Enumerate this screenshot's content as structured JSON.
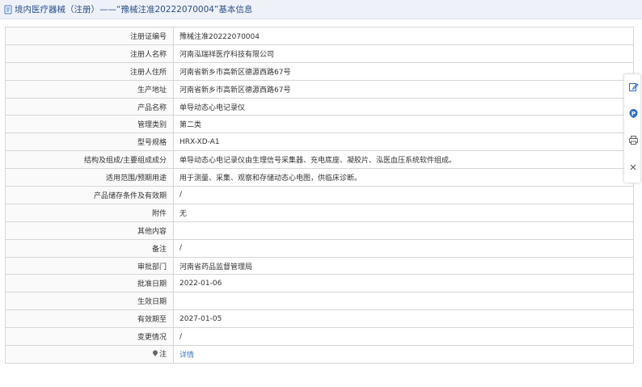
{
  "header": {
    "title": "境内医疗器械（注册）——“豫械注准20222070004”基本信息"
  },
  "rows": [
    {
      "label": "注册证编号",
      "value": "豫械注准20222070004"
    },
    {
      "label": "注册人名称",
      "value": "河南泓瑞祥医疗科技有限公司"
    },
    {
      "label": "注册人住所",
      "value": "河南省新乡市高新区德源西路67号"
    },
    {
      "label": "生产地址",
      "value": "河南省新乡市高新区德源西路67号"
    },
    {
      "label": "产品名称",
      "value": "单导动态心电记录仪"
    },
    {
      "label": "管理类别",
      "value": "第二类"
    },
    {
      "label": "型号规格",
      "value": "HRX-XD-A1"
    },
    {
      "label": "结构及组成/主要组成成分",
      "value": "单导动态心电记录仪由生理信号采集器、充电底座、凝胶片、泓医血压系统软件组成。"
    },
    {
      "label": "适用范围/预期用途",
      "value": "用于测量、采集、观察和存储动态心电图，供临床诊断。"
    },
    {
      "label": "产品储存条件及有效期",
      "value": "/"
    },
    {
      "label": "附件",
      "value": "无"
    },
    {
      "label": "其他内容",
      "value": ""
    },
    {
      "label": "备注",
      "value": "/"
    },
    {
      "label": "审批部门",
      "value": "河南省药品监督管理局"
    },
    {
      "label": "批准日期",
      "value": "2022-01-06"
    },
    {
      "label": "生效日期",
      "value": ""
    },
    {
      "label": "有效期至",
      "value": "2027-01-05"
    },
    {
      "label": "变更情况",
      "value": "/"
    }
  ],
  "note_row": {
    "label": "注",
    "link_text": "详情"
  },
  "icons": {
    "header": "document-icon",
    "note": "note-pin-icon",
    "sidebar": [
      "edit-icon",
      "parking-p-icon",
      "print-icon",
      "close-icon"
    ]
  },
  "colors": {
    "header_bg": "#eef2f8",
    "header_text": "#2a4f8a",
    "link": "#3a78c8",
    "sidebar_accent": "#2e6fce"
  }
}
